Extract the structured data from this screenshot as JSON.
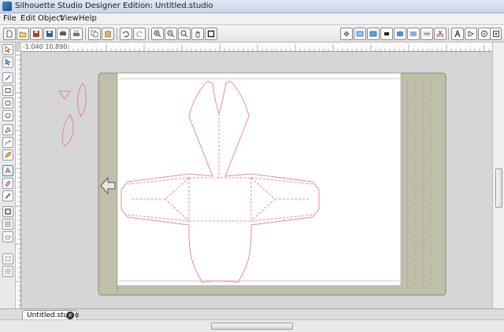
{
  "window": {
    "title": "Silhouette Studio Designer Edition: Untitled.studio"
  },
  "menu": {
    "items": [
      "File",
      "Edit",
      "Object",
      "View",
      "Help"
    ]
  },
  "ruler": {
    "coordinates": "-1.040  10.890"
  },
  "tabs": [
    {
      "label": "Untitled.studio",
      "close_icon": "×"
    }
  ],
  "colors": {
    "cut_line": "#e8707a",
    "mat": "#bfbfaa",
    "canvas": "#d6d6d6",
    "page": "#ffffff"
  }
}
